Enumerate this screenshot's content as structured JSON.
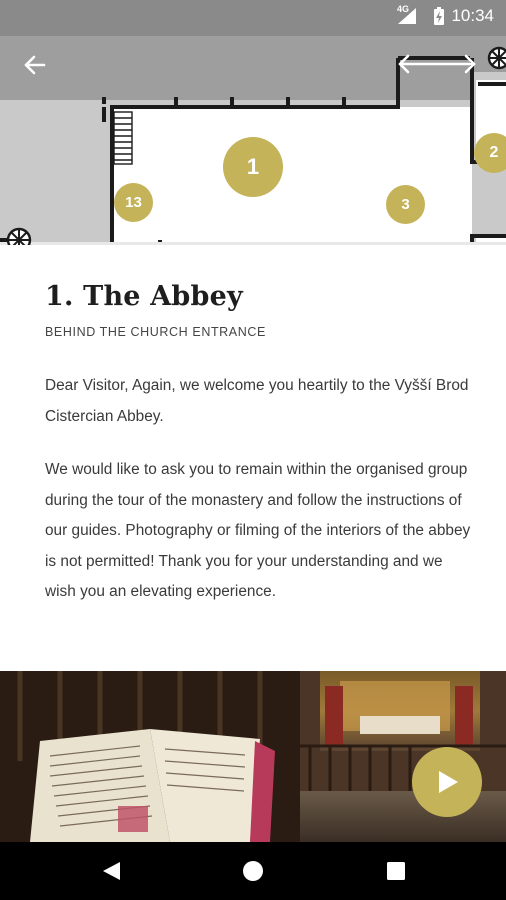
{
  "status_bar": {
    "time": "10:34",
    "network": "4G",
    "icons": [
      "signal-icon",
      "battery-icon"
    ]
  },
  "map": {
    "markers": [
      {
        "label": "1"
      },
      {
        "label": "2"
      },
      {
        "label": "3"
      },
      {
        "label": "13"
      }
    ],
    "icons": [
      "back-arrow-icon",
      "expand-arrows-icon",
      "wheel-icon"
    ]
  },
  "stop": {
    "title": "1. The Abbey",
    "subtitle": "BEHIND THE CHURCH ENTRANCE",
    "paragraphs": [
      "Dear Visitor, Again, we welcome you heartily to the Vyšší Brod Cistercian Abbey.",
      "We would like to ask you to remain within the organised group during the tour of the monastery and follow the instructions of our guides. Photography or filming of the interiors of the abbey is not permitted! Thank you for your understanding and we wish you an elevating experience."
    ]
  },
  "media": {
    "icons": [
      "play-icon"
    ]
  },
  "nav_bar": {
    "icons": [
      "back-triangle-icon",
      "home-circle-icon",
      "recents-square-icon"
    ]
  },
  "colors": {
    "accent": "#c4b358",
    "map_background": "#c9c9c9",
    "floor": "#ffffff",
    "walls": "#1b1b1b",
    "text": "#3a3a3a"
  }
}
